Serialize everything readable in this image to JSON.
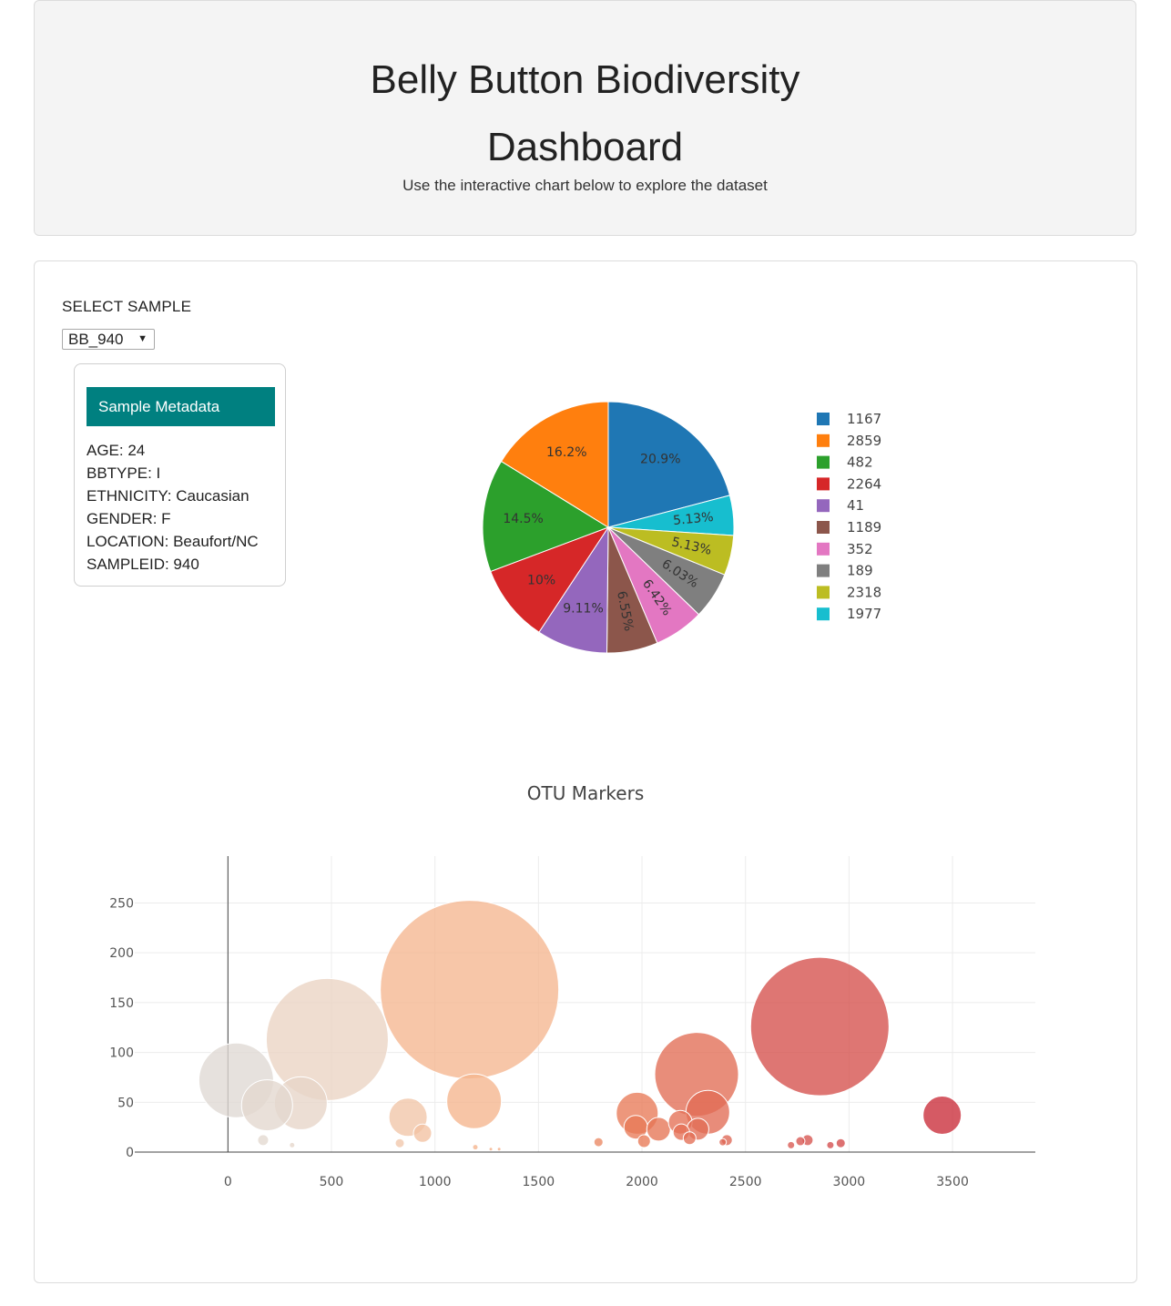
{
  "header": {
    "title_line1": "Belly Button Biodiversity",
    "title_line2": "Dashboard",
    "subtitle": "Use the interactive chart below to explore the dataset"
  },
  "selector": {
    "label": "SELECT SAMPLE",
    "value": "BB_940"
  },
  "metadata": {
    "title": "Sample Metadata",
    "lines": [
      "AGE: 24",
      "BBTYPE: I",
      "ETHNICITY: Caucasian",
      "GENDER: F",
      "LOCATION: Beaufort/NC",
      "SAMPLEID: 940"
    ]
  },
  "colors": {
    "metadata_header": "#008080",
    "pie_palette": [
      "#1f77b4",
      "#ff7f0e",
      "#2ca02c",
      "#d62728",
      "#9467bd",
      "#8c564b",
      "#e377c2",
      "#7f7f7f",
      "#bcbd22",
      "#17becf"
    ]
  },
  "chart_data": [
    {
      "type": "pie",
      "labels": [
        "1167",
        "2859",
        "482",
        "2264",
        "41",
        "1189",
        "352",
        "189",
        "2318",
        "1977"
      ],
      "values": [
        20.9,
        16.2,
        14.5,
        10,
        9.11,
        6.55,
        6.42,
        6.03,
        5.13,
        5.13
      ],
      "slice_order": [
        "1167",
        "1977",
        "2318",
        "189",
        "352",
        "1189",
        "41",
        "2264",
        "482",
        "2859"
      ],
      "text_labels": {
        "1167": "20.9%",
        "2859": "16.2%",
        "482": "14.5%",
        "2264": "10%",
        "41": "9.11%",
        "1189": "6.55%",
        "352": "6.42%",
        "189": "6.03%",
        "2318": "5.13%",
        "1977": "5.13%"
      },
      "legend_position": "right"
    },
    {
      "type": "scatter",
      "title": "OTU Markers",
      "xticks": [
        0,
        500,
        1000,
        1500,
        2000,
        2500,
        3000,
        3500
      ],
      "yticks": [
        0,
        50,
        100,
        150,
        200,
        250
      ],
      "xlim": [
        -450,
        3900
      ],
      "ylim": [
        -10,
        297
      ],
      "grid": true,
      "points": [
        {
          "x": 40,
          "y": 72,
          "r": 41
        },
        {
          "x": 480,
          "y": 113,
          "r": 67
        },
        {
          "x": 1167,
          "y": 163,
          "r": 98
        },
        {
          "x": 2264,
          "y": 78,
          "r": 46
        },
        {
          "x": 2859,
          "y": 126,
          "r": 76
        },
        {
          "x": 3450,
          "y": 37,
          "r": 21
        },
        {
          "x": 189,
          "y": 47,
          "r": 28
        },
        {
          "x": 352,
          "y": 49,
          "r": 29
        },
        {
          "x": 1189,
          "y": 51,
          "r": 30
        },
        {
          "x": 870,
          "y": 35,
          "r": 21
        },
        {
          "x": 940,
          "y": 19,
          "r": 10
        },
        {
          "x": 1977,
          "y": 39,
          "r": 23
        },
        {
          "x": 1970,
          "y": 25,
          "r": 13
        },
        {
          "x": 2080,
          "y": 23,
          "r": 13
        },
        {
          "x": 2185,
          "y": 30,
          "r": 13
        },
        {
          "x": 2190,
          "y": 20,
          "r": 9
        },
        {
          "x": 2318,
          "y": 40,
          "r": 24
        },
        {
          "x": 2270,
          "y": 23,
          "r": 12
        },
        {
          "x": 2230,
          "y": 14,
          "r": 7
        },
        {
          "x": 2010,
          "y": 11,
          "r": 7
        },
        {
          "x": 2410,
          "y": 12,
          "r": 6
        },
        {
          "x": 2390,
          "y": 10,
          "r": 4
        },
        {
          "x": 2765,
          "y": 11,
          "r": 5
        },
        {
          "x": 2800,
          "y": 12,
          "r": 6
        },
        {
          "x": 2720,
          "y": 7,
          "r": 4
        },
        {
          "x": 2910,
          "y": 7,
          "r": 4
        },
        {
          "x": 2960,
          "y": 9,
          "r": 5
        },
        {
          "x": 170,
          "y": 12,
          "r": 6
        },
        {
          "x": 310,
          "y": 7,
          "r": 3
        },
        {
          "x": 830,
          "y": 9,
          "r": 5
        },
        {
          "x": 1790,
          "y": 10,
          "r": 5
        },
        {
          "x": 1195,
          "y": 5,
          "r": 3
        },
        {
          "x": 1270,
          "y": 3,
          "r": 2
        },
        {
          "x": 1310,
          "y": 3,
          "r": 2
        }
      ]
    }
  ]
}
